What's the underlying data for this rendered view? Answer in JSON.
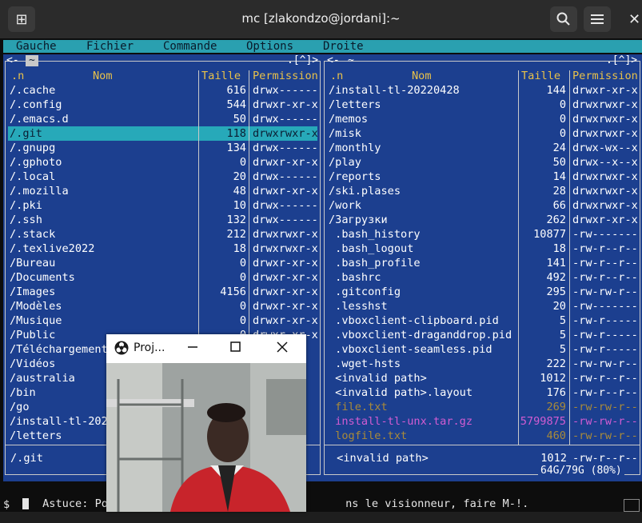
{
  "window": {
    "title": "mc [zlakondzo@jordani]:~"
  },
  "menu": [
    "Gauche",
    "Fichier",
    "Commande",
    "Options",
    "Droite"
  ],
  "left_panel": {
    "path": "~",
    "corner": ".[^]>",
    "nav": "<-",
    "headers": {
      "n": ".n",
      "name": "Nom",
      "size": "Taille",
      "perm": "Permission"
    },
    "rows": [
      {
        "name": "/.cache",
        "size": "616",
        "perm": "drwx------"
      },
      {
        "name": "/.config",
        "size": "544",
        "perm": "drwxr-xr-x"
      },
      {
        "name": "/.emacs.d",
        "size": "50",
        "perm": "drwx------"
      },
      {
        "name": "/.git",
        "size": "118",
        "perm": "drwxrwxr-x",
        "selected": true
      },
      {
        "name": "/.gnupg",
        "size": "134",
        "perm": "drwx------"
      },
      {
        "name": "/.gphoto",
        "size": "0",
        "perm": "drwxr-xr-x"
      },
      {
        "name": "/.local",
        "size": "20",
        "perm": "drwx------"
      },
      {
        "name": "/.mozilla",
        "size": "48",
        "perm": "drwxr-xr-x"
      },
      {
        "name": "/.pki",
        "size": "10",
        "perm": "drwx------"
      },
      {
        "name": "/.ssh",
        "size": "132",
        "perm": "drwx------"
      },
      {
        "name": "/.stack",
        "size": "212",
        "perm": "drwxrwxr-x"
      },
      {
        "name": "/.texlive2022",
        "size": "18",
        "perm": "drwxrwxr-x"
      },
      {
        "name": "/Bureau",
        "size": "0",
        "perm": "drwxr-xr-x"
      },
      {
        "name": "/Documents",
        "size": "0",
        "perm": "drwxr-xr-x"
      },
      {
        "name": "/Images",
        "size": "4156",
        "perm": "drwxr-xr-x"
      },
      {
        "name": "/Modèles",
        "size": "0",
        "perm": "drwxr-xr-x"
      },
      {
        "name": "/Musique",
        "size": "0",
        "perm": "drwxr-xr-x"
      },
      {
        "name": "/Public",
        "size": "0",
        "perm": "drwxr-xr-x"
      },
      {
        "name": "/Téléchargement",
        "size": "",
        "perm": ""
      },
      {
        "name": "/Vidéos",
        "size": "",
        "perm": ""
      },
      {
        "name": "/australia",
        "size": "",
        "perm": ""
      },
      {
        "name": "/bin",
        "size": "",
        "perm": ""
      },
      {
        "name": "/go",
        "size": "",
        "perm": ""
      },
      {
        "name": "/install-tl-202",
        "size": "",
        "perm": ""
      },
      {
        "name": "/letters",
        "size": "",
        "perm": ""
      }
    ],
    "footer": "/.git"
  },
  "right_panel": {
    "path": "~",
    "corner": ".[^]>",
    "nav": "<-",
    "headers": {
      "n": ".n",
      "name": "Nom",
      "size": "Taille",
      "perm": "Permission"
    },
    "rows": [
      {
        "name": "/install-tl-20220428",
        "size": "144",
        "perm": "drwxr-xr-x"
      },
      {
        "name": "/letters",
        "size": "0",
        "perm": "drwxrwxr-x"
      },
      {
        "name": "/memos",
        "size": "0",
        "perm": "drwxrwxr-x"
      },
      {
        "name": "/misk",
        "size": "0",
        "perm": "drwxrwxr-x"
      },
      {
        "name": "/monthly",
        "size": "24",
        "perm": "drwx-wx--x"
      },
      {
        "name": "/play",
        "size": "50",
        "perm": "drwx--x--x"
      },
      {
        "name": "/reports",
        "size": "14",
        "perm": "drwxrwxr-x"
      },
      {
        "name": "/ski.plases",
        "size": "28",
        "perm": "drwxrwxr-x"
      },
      {
        "name": "/work",
        "size": "66",
        "perm": "drwxrwxr-x"
      },
      {
        "name": "/Загрузки",
        "size": "262",
        "perm": "drwxr-xr-x"
      },
      {
        "name": " .bash_history",
        "size": "10877",
        "perm": "-rw-------"
      },
      {
        "name": " .bash_logout",
        "size": "18",
        "perm": "-rw-r--r--"
      },
      {
        "name": " .bash_profile",
        "size": "141",
        "perm": "-rw-r--r--"
      },
      {
        "name": " .bashrc",
        "size": "492",
        "perm": "-rw-r--r--"
      },
      {
        "name": " .gitconfig",
        "size": "295",
        "perm": "-rw-rw-r--"
      },
      {
        "name": " .lesshst",
        "size": "20",
        "perm": "-rw-------"
      },
      {
        "name": " .vboxclient-clipboard.pid",
        "size": "5",
        "perm": "-rw-r-----"
      },
      {
        "name": " .vboxclient-draganddrop.pid",
        "size": "5",
        "perm": "-rw-r-----"
      },
      {
        "name": " .vboxclient-seamless.pid",
        "size": "5",
        "perm": "-rw-r-----"
      },
      {
        "name": " .wget-hsts",
        "size": "222",
        "perm": "-rw-rw-r--"
      },
      {
        "name": " <invalid path>",
        "size": "1012",
        "perm": "-rw-r--r--"
      },
      {
        "name": " <invalid path>.layout",
        "size": "176",
        "perm": "-rw-r--r--"
      },
      {
        "name": " file.txt",
        "size": "269",
        "perm": "-rw-rw-r--",
        "style": "dim"
      },
      {
        "name": " install-tl-unx.tar.gz",
        "size": "5799875",
        "perm": "-rw-rw-r--",
        "style": "archive"
      },
      {
        "name": " logfile.txt",
        "size": "460",
        "perm": "-rw-rw-r--",
        "style": "dim"
      }
    ],
    "footer_name": " <invalid path>",
    "footer_size": "1012",
    "footer_perm": "-rw-r--r--",
    "disk": "64G/79G (80%)"
  },
  "status": {
    "hint_left": "Astuce: Pour voi",
    "hint_right": "ns le visionneur, faire M-!.",
    "prompt": "$"
  },
  "webcam": {
    "title": "Proj..."
  },
  "colors": {
    "panel": "#1c3f8f",
    "selection": "#27a9b9",
    "header": "#e8c14a",
    "archive": "#d25cd2",
    "dim": "#a88a3a"
  }
}
